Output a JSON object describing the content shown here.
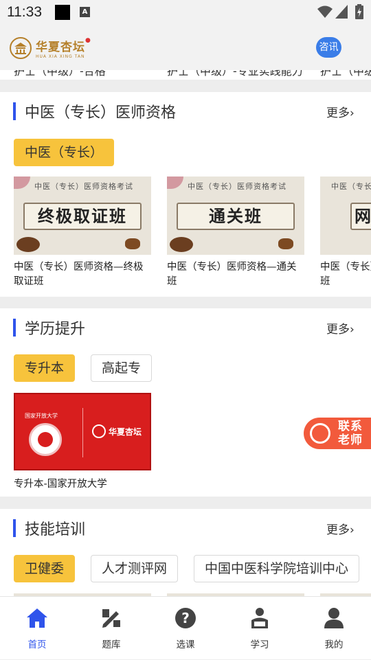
{
  "status": {
    "time": "11:33",
    "a_label": "A"
  },
  "header": {
    "brand": "华夏杏坛",
    "brand_sub": "HUA XIA XING TAN",
    "news_button": "咨讯"
  },
  "cut_row": [
    "护士（中级）-合格",
    "护士（中级）-专业实践能力",
    "护士（中级）"
  ],
  "sections": {
    "tcm": {
      "title": "中医（专长）医师资格",
      "more": "更多",
      "chips": [
        "中医（专长）"
      ],
      "courses": [
        {
          "banner": "中医（专长）医师资格考试",
          "scroll": "终极取证班",
          "caption": "中医（专长）医师资格—终极取证班"
        },
        {
          "banner": "中医（专长）医师资格考试",
          "scroll": "通关班",
          "caption": "中医（专长）医师资格—通关班"
        },
        {
          "banner": "中医（专长）医师资格考试",
          "scroll": "网",
          "caption": "中医（专长）医师资格—网课班"
        }
      ]
    },
    "edu": {
      "title": "学历提升",
      "more": "更多",
      "chips": [
        "专升本",
        "高起专"
      ],
      "courses": [
        {
          "thumb_left": "国家开放大学",
          "thumb_brand": "华夏杏坛",
          "caption": "专升本-国家开放大学"
        }
      ]
    },
    "skill": {
      "title": "技能培训",
      "more": "更多",
      "chips": [
        "卫健委",
        "人才测评网",
        "中国中医科学院培训中心"
      ]
    }
  },
  "contact": {
    "line1": "联系",
    "line2": "老师"
  },
  "tabs": [
    {
      "label": "首页",
      "icon": "home-icon",
      "active": true
    },
    {
      "label": "题库",
      "icon": "question-bank-icon",
      "active": false
    },
    {
      "label": "选课",
      "icon": "question-icon",
      "active": false
    },
    {
      "label": "学习",
      "icon": "study-icon",
      "active": false
    },
    {
      "label": "我的",
      "icon": "user-icon",
      "active": false
    }
  ],
  "colors": {
    "accent": "#2f54eb",
    "chip_active": "#f7c33c",
    "contact": "#f25a3c",
    "brand": "#b5802a"
  }
}
